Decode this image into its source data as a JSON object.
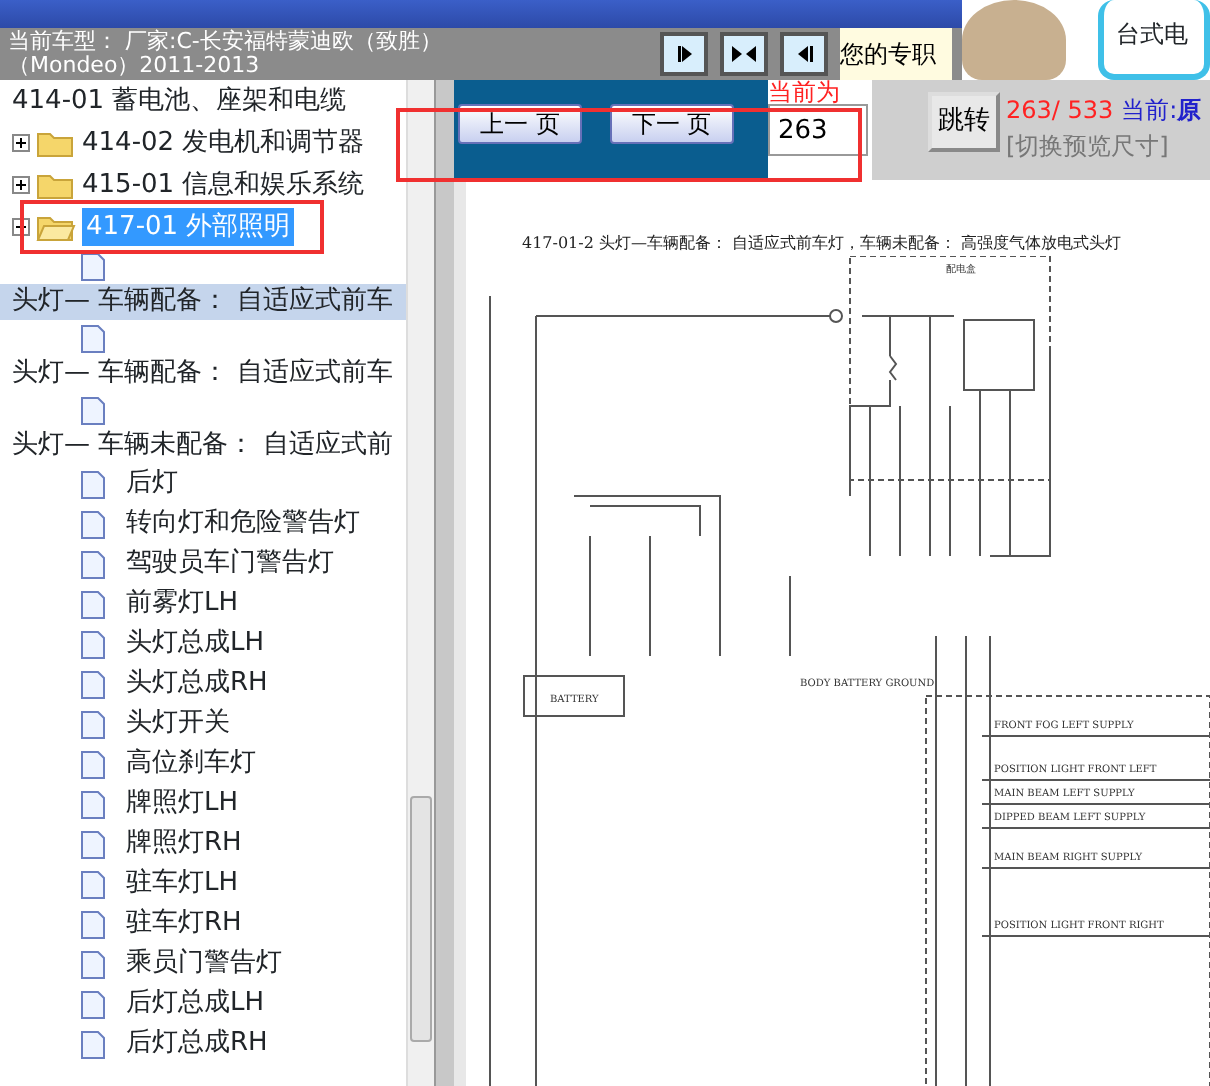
{
  "header": {
    "logo_text": "台式电"
  },
  "vehicle_bar": {
    "label": "当前车型：",
    "value": "厂家:C-长安福特蒙迪欧（致胜）",
    "value_line_2": "（Mondeo）2011-2013",
    "notice": "您的专职"
  },
  "tree": [
    {
      "kind": "heading",
      "label": "414-01 蓄电池、座架和电缆",
      "selected": false
    },
    {
      "kind": "folder",
      "label": "414-02 发电机和调节器",
      "expanded": false,
      "selected": false
    },
    {
      "kind": "folder",
      "label": "415-01 信息和娱乐系统",
      "expanded": false,
      "selected": false
    },
    {
      "kind": "folder",
      "label": "417-01 外部照明",
      "expanded": true,
      "selected": true,
      "outlined": true,
      "children": [
        {
          "kind": "page",
          "selected": false
        },
        {
          "kind": "heading",
          "label": "头灯— 车辆配备： 自适应式前车",
          "selected": false,
          "highlighted": true
        },
        {
          "kind": "page",
          "selected": false
        },
        {
          "kind": "heading",
          "label": "头灯— 车辆配备： 自适应式前车",
          "selected": false,
          "highlighted": false
        },
        {
          "kind": "page",
          "selected": false
        },
        {
          "kind": "heading",
          "label": "头灯— 车辆未配备： 自适应式前",
          "selected": false,
          "highlighted": false
        },
        {
          "kind": "page",
          "label": "后灯",
          "selected": false
        },
        {
          "kind": "page",
          "label": "转向灯和危险警告灯",
          "selected": false
        },
        {
          "kind": "page",
          "label": "驾驶员车门警告灯",
          "selected": false
        },
        {
          "kind": "page",
          "label": "前雾灯LH",
          "selected": false
        },
        {
          "kind": "page",
          "label": "头灯总成LH",
          "selected": false
        },
        {
          "kind": "page",
          "label": "头灯总成RH",
          "selected": false
        },
        {
          "kind": "page",
          "label": "头灯开关",
          "selected": false
        },
        {
          "kind": "page",
          "label": "高位刹车灯",
          "selected": false
        },
        {
          "kind": "page",
          "label": "牌照灯LH",
          "selected": false
        },
        {
          "kind": "page",
          "label": "牌照灯RH",
          "selected": false
        },
        {
          "kind": "page",
          "label": "驻车灯LH",
          "selected": false
        },
        {
          "kind": "page",
          "label": "驻车灯RH",
          "selected": false
        },
        {
          "kind": "page",
          "label": "乘员门警告灯",
          "selected": false
        },
        {
          "kind": "page",
          "label": "后灯总成LH",
          "selected": false
        },
        {
          "kind": "page",
          "label": "后灯总成RH",
          "selected": false
        }
      ]
    }
  ],
  "pager": {
    "outlined": true,
    "prev": "上一 页",
    "next": "下一 页",
    "current_label": "当前为",
    "page_value": "263",
    "jump": "跳转",
    "page_count": "263/ 533",
    "mode": "当前:**原**",
    "toggle": "[切换预览尺寸]"
  },
  "document": {
    "title": "417-01-2 头灯—车辆配备： 自适应式前车灯，车辆未配备： 高强度气体放电式头灯",
    "labels": [
      "配电盒",
      "BODY BATTERY GROUND",
      "BATTERY",
      "FRONT FOG LEFT SUPPLY",
      "POSITION LIGHT FRONT LEFT",
      "MAIN BEAM LEFT SUPPLY",
      "DIPPED BEAM LEFT SUPPLY",
      "MAIN BEAM RIGHT SUPPLY",
      "POSITION LIGHT FRONT RIGHT"
    ]
  }
}
